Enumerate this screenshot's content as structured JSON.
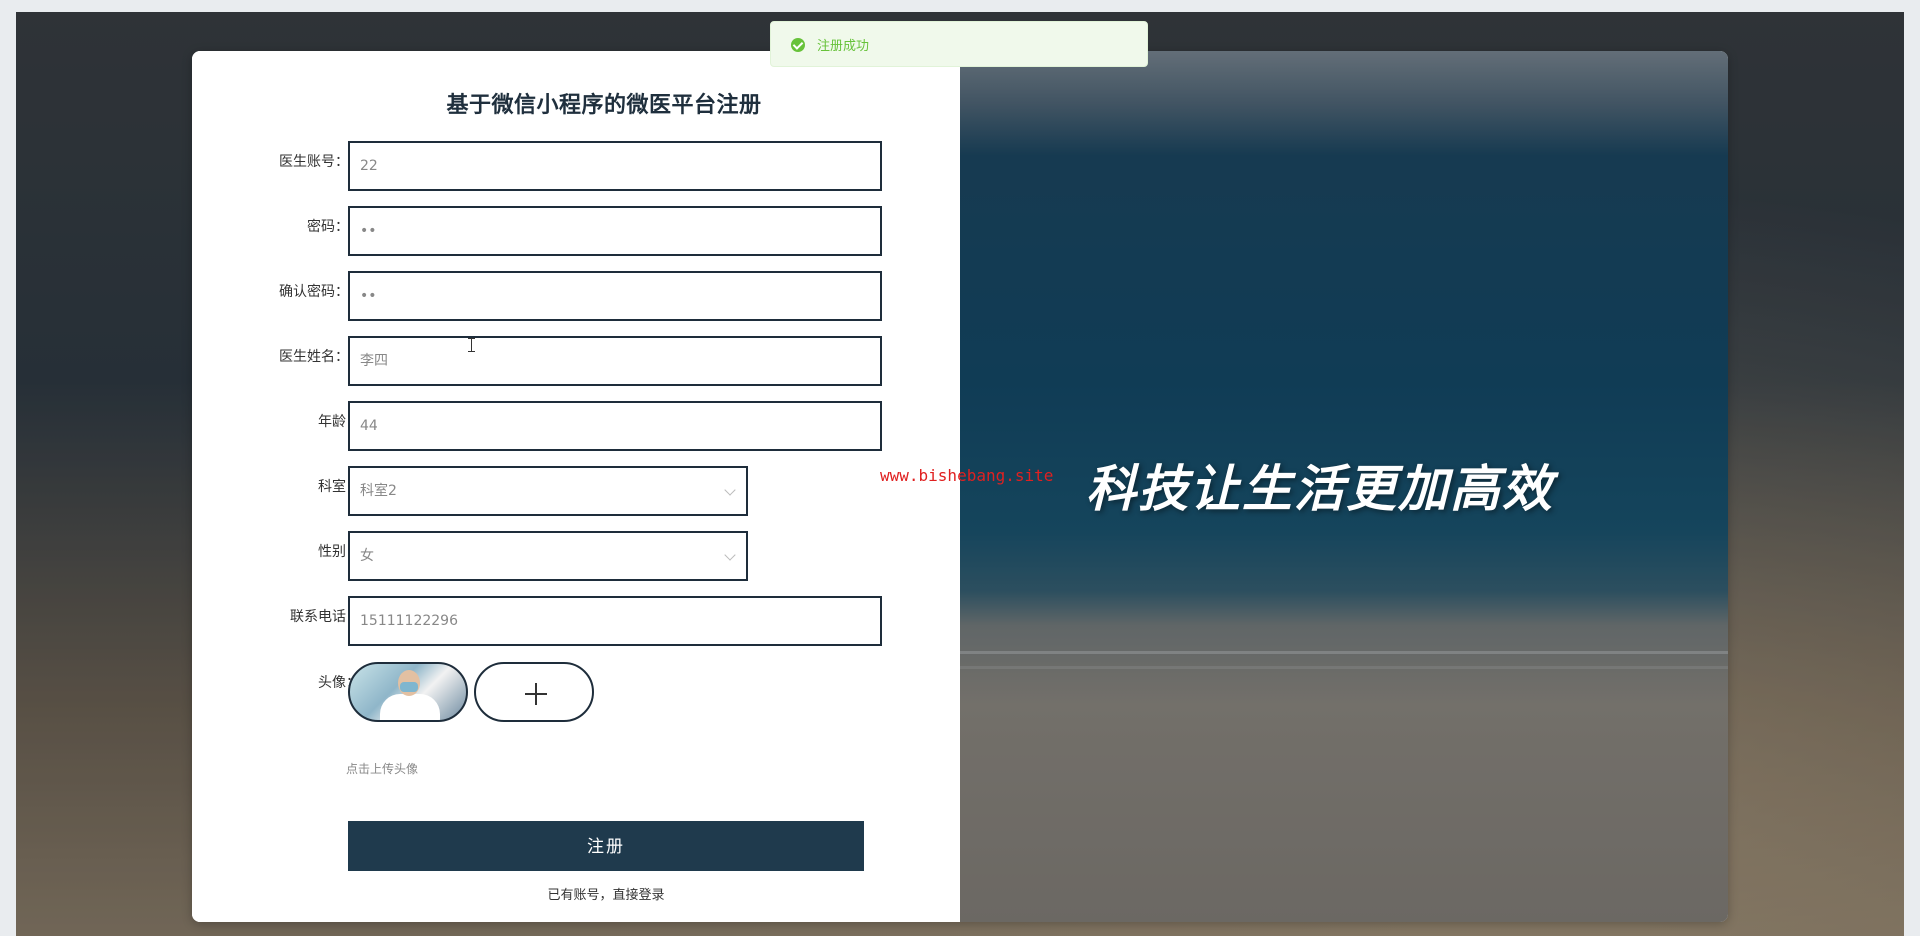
{
  "toast": {
    "message": "注册成功",
    "color": "#67c23a"
  },
  "form": {
    "title": "基于微信小程序的微医平台注册",
    "fields": {
      "account": {
        "label": "医生账号：",
        "required": true,
        "value": "22"
      },
      "password": {
        "label": "密码：",
        "required": true,
        "value": "••"
      },
      "confirm_password": {
        "label": "确认密码：",
        "required": true,
        "value": "••"
      },
      "doctor_name": {
        "label": "医生姓名：",
        "required": true,
        "value": "李四"
      },
      "age": {
        "label": "年龄：",
        "required": false,
        "value": "44"
      },
      "department": {
        "label": "科室：",
        "required": false,
        "value": "科室2"
      },
      "gender": {
        "label": "性别：",
        "required": false,
        "value": "女"
      },
      "phone": {
        "label": "联系电话：",
        "required": false,
        "value": "15111122296"
      },
      "avatar": {
        "label": "头像：",
        "required": false,
        "upload_tip": "点击上传头像"
      }
    },
    "required_mark": "*",
    "submit_label": "注册",
    "login_link": "已有账号，直接登录"
  },
  "hero": {
    "slogan": "科技让生活更加高效"
  },
  "watermark": {
    "text": "www.bishebang.site"
  },
  "colors": {
    "primary": "#1f3a4d",
    "input_border": "#1e2d3b",
    "required": "#f56c6c",
    "success": "#67c23a"
  }
}
